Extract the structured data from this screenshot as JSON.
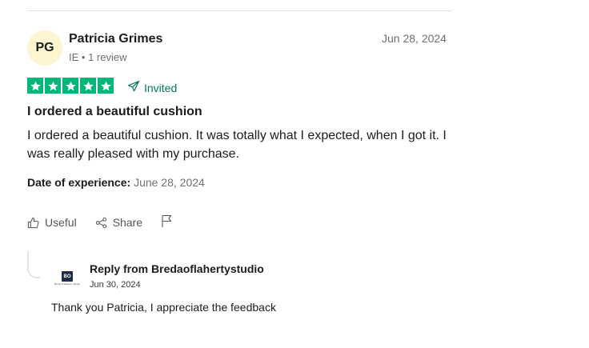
{
  "review": {
    "avatar_initials": "PG",
    "reviewer_name": "Patricia Grimes",
    "country": "IE",
    "review_count": "1 review",
    "date": "Jun 28, 2024",
    "rating": 5,
    "rating_color": "#00b67a",
    "invited_label": "Invited",
    "title": "I ordered a beautiful cushion",
    "body": "I ordered a beautiful cushion. It was totally what I expected, when I got it. I was really pleased with my purchase.",
    "experience_label": "Date of experience:",
    "experience_date": "June 28, 2024"
  },
  "actions": {
    "useful_label": "Useful",
    "share_label": "Share"
  },
  "reply": {
    "logo_mark": "BO",
    "logo_text": "Breda O'Flaherty Studio",
    "from": "Reply from Bredaoflahertystudio",
    "date": "Jun 30, 2024",
    "body": "Thank you Patricia, I appreciate the feedback"
  }
}
